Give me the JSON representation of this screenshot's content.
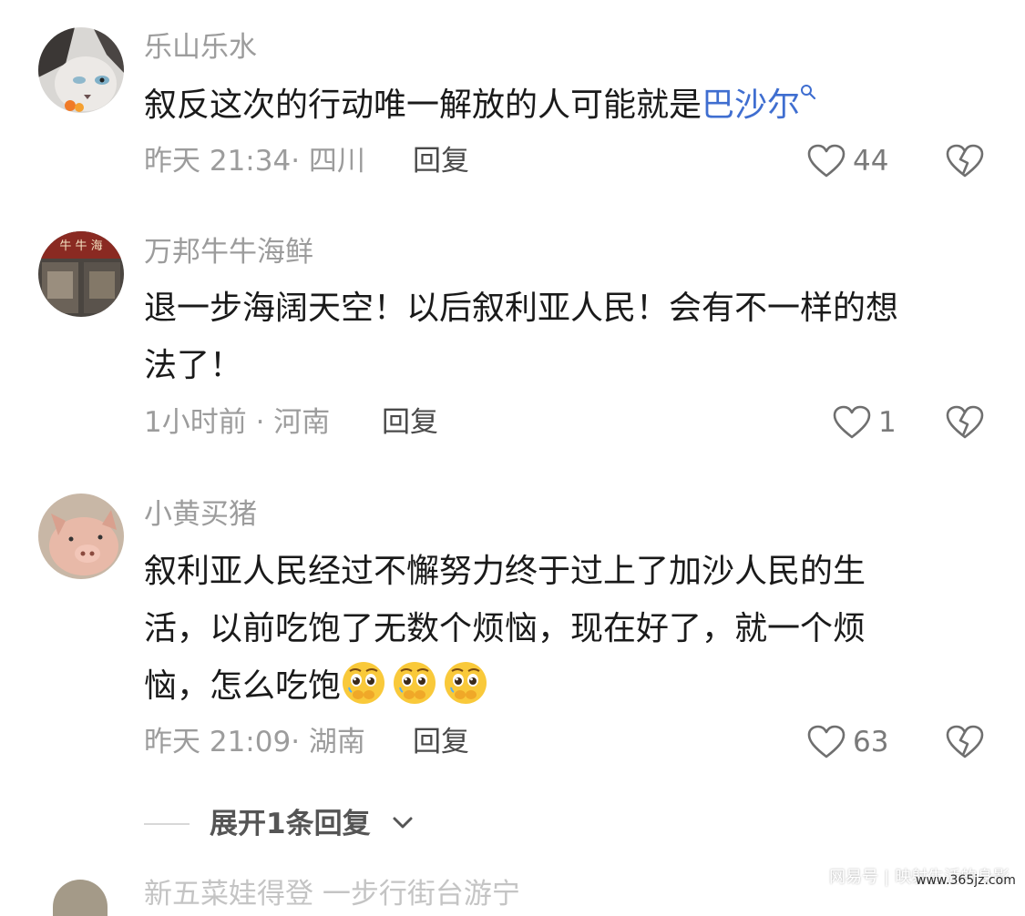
{
  "colors": {
    "username": "#9c9c9c",
    "text": "#1a1a1a",
    "mention": "#3f6ed0",
    "meta": "#9c9c9c",
    "reply": "#4a4a4a",
    "icon": "#6f6f6f"
  },
  "comments": [
    {
      "username": "乐山乐水",
      "text": "叙反这次的行动唯一解放的人可能就是",
      "mention": "巴沙尔",
      "mention_icon": "search-icon",
      "time_location": "昨天 21:34· 四川",
      "reply_label": "回复",
      "likes": "44",
      "like_icon": "heart-icon",
      "dislike_icon": "broken-heart-icon"
    },
    {
      "username": "万邦牛牛海鲜",
      "text_line1": "退一步海阔天空！以后叙利亚人民！会有不一样的想",
      "text_line2": "法了！",
      "time_location": "1小时前 · 河南",
      "reply_label": "回复",
      "likes": "1",
      "like_icon": "heart-icon",
      "dislike_icon": "broken-heart-icon"
    },
    {
      "username": "小黄买猪",
      "text_line1": "叙利亚人民经过不懈努力终于过上了加沙人民的生",
      "text_line2": "活，以前吃饱了无数个烦恼，现在好了，就一个烦",
      "text_line3": "恼，怎么吃饱",
      "emojis": [
        "pleading-face-emoji",
        "pleading-face-emoji",
        "pleading-face-emoji"
      ],
      "time_location": "昨天 21:09· 湖南",
      "reply_label": "回复",
      "likes": "63",
      "like_icon": "heart-icon",
      "dislike_icon": "broken-heart-icon"
    }
  ],
  "expand_replies": {
    "label": "展开1条回复",
    "icon": "chevron-down-icon"
  },
  "next_comment_peek": {
    "text": "新五菜娃得登 一步行街台游宁"
  },
  "watermark": {
    "brand": "网易号",
    "separator": "|",
    "author": "映射生活的身影",
    "url": "www.365jz.com"
  }
}
